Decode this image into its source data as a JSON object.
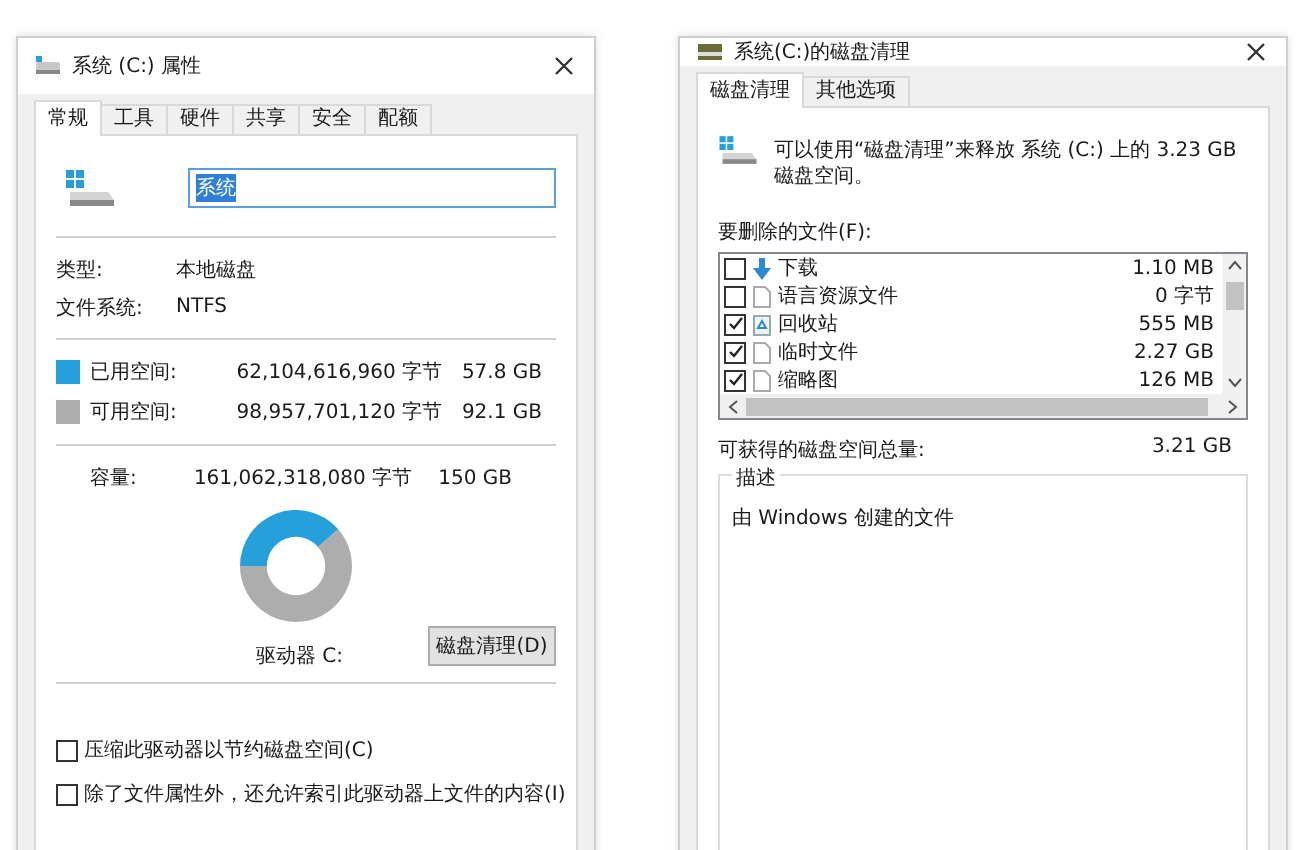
{
  "left_window": {
    "title": "系统 (C:) 属性",
    "tabs": [
      {
        "label": "常规",
        "selected": true
      },
      {
        "label": "工具",
        "selected": false
      },
      {
        "label": "硬件",
        "selected": false
      },
      {
        "label": "共享",
        "selected": false
      },
      {
        "label": "安全",
        "selected": false
      },
      {
        "label": "配额",
        "selected": false
      }
    ],
    "name_field": {
      "value": "系统",
      "selected": true
    },
    "info": [
      {
        "label": "类型:",
        "value": "本地磁盘"
      },
      {
        "label": "文件系统:",
        "value": "NTFS"
      }
    ],
    "space": [
      {
        "label": "已用空间:",
        "bytes": "62,104,616,960 字节",
        "size": "57.8 GB",
        "color": "#26a0da"
      },
      {
        "label": "可用空间:",
        "bytes": "98,957,701,120 字节",
        "size": "92.1 GB",
        "color": "#adadad"
      }
    ],
    "capacity": {
      "label": "容量:",
      "bytes": "161,062,318,080 字节",
      "size": "150 GB"
    },
    "chart_data": {
      "type": "donut",
      "values": [
        38.6,
        61.4
      ]
    },
    "drive_label": "驱动器 C:",
    "cleanup_button": "磁盘清理(D)",
    "options": [
      {
        "label": "压缩此驱动器以节约磁盘空间(C)",
        "checked": false
      },
      {
        "label": "除了文件属性外，还允许索引此驱动器上文件的内容(I)",
        "checked": false
      }
    ]
  },
  "right_window": {
    "title": "系统(C:)的磁盘清理",
    "tabs": [
      {
        "label": "磁盘清理",
        "selected": true
      },
      {
        "label": "其他选项",
        "selected": false
      }
    ],
    "intro": "可以使用“磁盘清理”来释放 系统 (C:) 上的 3.23 GB 磁盘空间。",
    "files_label": "要删除的文件(F):",
    "files": [
      {
        "kind": "download",
        "name": "下载",
        "size": "1.10 MB",
        "checked": false
      },
      {
        "kind": "file",
        "name": "语言资源文件",
        "size": "0 字节",
        "checked": false
      },
      {
        "kind": "recycle",
        "name": "回收站",
        "size": "555 MB",
        "checked": true
      },
      {
        "kind": "file",
        "name": "临时文件",
        "size": "2.27 GB",
        "checked": true
      },
      {
        "kind": "file",
        "name": "缩略图",
        "size": "126 MB",
        "checked": true
      }
    ],
    "total_label": "可获得的磁盘空间总量:",
    "total_value": "3.21 GB",
    "description": {
      "title": "描述",
      "text": "由 Windows 创建的文件"
    }
  }
}
